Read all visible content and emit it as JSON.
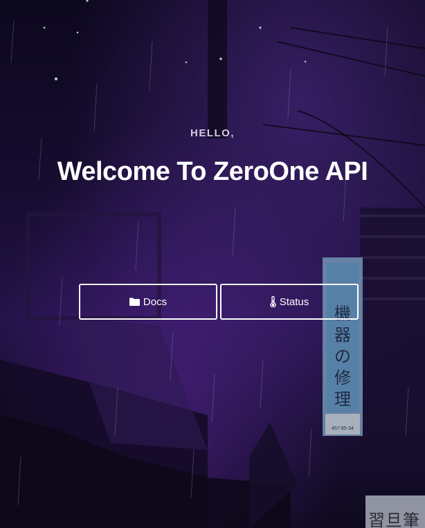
{
  "hero": {
    "eyebrow": "HELLO,",
    "title": "Welcome To ZeroOne API"
  },
  "buttons": {
    "docs": {
      "label": "Docs",
      "icon": "folder-icon"
    },
    "status": {
      "label": "Status",
      "icon": "thermometer-icon"
    }
  },
  "background": {
    "sign_characters": [
      "機",
      "器",
      "の",
      "修",
      "理"
    ],
    "sign_small_text": "457-65-34",
    "corner_sign_text": "習旦筆",
    "colors": {
      "accent_purple": "#5a2aa0",
      "sign_blue": "#6fa8d6"
    }
  }
}
